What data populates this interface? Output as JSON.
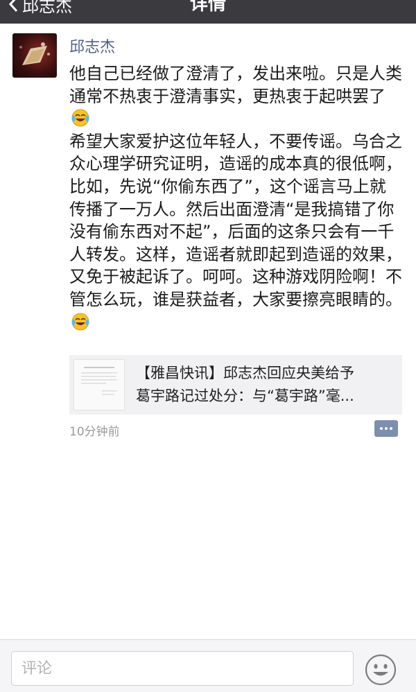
{
  "nav": {
    "back_label": "邱志杰",
    "title": "详情"
  },
  "post": {
    "author": "邱志杰",
    "text_parts": [
      "他自己已经做了澄清了，发出来啦。只是人类通常不热衷于澄清事实，更热衷于起哄罢了",
      "\n希望大家爱护这位年轻人，不要传谣。乌合之众心理学研究证明，造谣的成本真的很低啊，比如，先说“你偷东西了”，这个谣言马上就传播了一万人。然后出面澄清“是我搞错了你没有偷东西对不起”，后面的这条只会有一千人转发。这样，造谣者就即起到造谣的效果，又免于被起诉了。呵呵。这种游戏阴险啊！不管怎么玩，谁是获益者，大家要擦亮眼睛的。"
    ],
    "inline_emoji": "laughing-tears-emoji",
    "link": {
      "title_line1": "【雅昌快讯】邱志杰回应央美给予",
      "title_line2": "葛宇路记过处分：与“葛宇路”毫..."
    },
    "time": "10分钟前"
  },
  "comment_bar": {
    "placeholder": "评论",
    "emoji_icon": "smiley-icon"
  },
  "colors": {
    "nav_bg": "#3a3a3f",
    "author_link": "#4f5f86",
    "link_card_bg": "#f1f1f3",
    "comment_button": "#7d8fae"
  }
}
